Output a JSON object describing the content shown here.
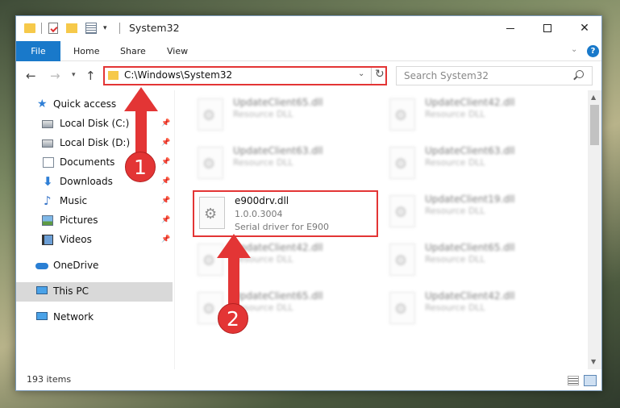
{
  "window": {
    "title": "System32",
    "quick_access_dropdown": "▾",
    "minimize": "",
    "maximize": "",
    "close": "✕"
  },
  "ribbon": {
    "tabs": [
      "File",
      "Home",
      "Share",
      "View"
    ],
    "collapse_chevron": "⌄",
    "help": "?"
  },
  "nav": {
    "back": "←",
    "forward": "→",
    "recent": "▾",
    "up": "↑",
    "address": "C:\\Windows\\System32",
    "address_dropdown": "⌄",
    "refresh": "↻",
    "search_placeholder": "Search System32"
  },
  "sidebar": {
    "items": [
      {
        "label": "Quick access",
        "icon": "star-icon",
        "pinned": false
      },
      {
        "label": "Local Disk (C:)",
        "icon": "drive-icon",
        "pinned": true
      },
      {
        "label": "Local Disk (D:)",
        "icon": "drive-icon",
        "pinned": true
      },
      {
        "label": "Documents",
        "icon": "documents-icon",
        "pinned": true
      },
      {
        "label": "Downloads",
        "icon": "downloads-icon",
        "pinned": true
      },
      {
        "label": "Music",
        "icon": "music-icon",
        "pinned": true
      },
      {
        "label": "Pictures",
        "icon": "pictures-icon",
        "pinned": true
      },
      {
        "label": "Videos",
        "icon": "videos-icon",
        "pinned": true
      },
      {
        "label": "OneDrive",
        "icon": "onedrive-icon",
        "pinned": false
      },
      {
        "label": "This PC",
        "icon": "this-pc-icon",
        "pinned": false,
        "selected": true
      },
      {
        "label": "Network",
        "icon": "network-icon",
        "pinned": false
      }
    ],
    "pin_glyph": "📌"
  },
  "files": {
    "left": [
      {
        "name": "UpdateClient65.dll",
        "type": "Resource DLL"
      },
      {
        "name": "UpdateClient63.dll",
        "type": "Resource DLL"
      },
      {
        "name": "e900drv.dll",
        "version": "1.0.0.3004",
        "description": "Serial driver for E900"
      },
      {
        "name": "UpdateClient42.dll",
        "type": "Resource DLL"
      },
      {
        "name": "UpdateClient65.dll",
        "type": "Resource DLL"
      }
    ],
    "right": [
      {
        "name": "UpdateClient42.dll",
        "type": "Resource DLL"
      },
      {
        "name": "UpdateClient63.dll",
        "type": "Resource DLL"
      },
      {
        "name": "UpdateClient19.dll",
        "type": "Resource DLL"
      },
      {
        "name": "UpdateClient65.dll",
        "type": "Resource DLL"
      },
      {
        "name": "UpdateClient42.dll",
        "type": "Resource DLL"
      }
    ]
  },
  "scrollbar": {
    "up": "▲",
    "down": "▼"
  },
  "status": {
    "item_count": "193 items"
  },
  "annotations": {
    "step1": "1",
    "step2": "2",
    "color": "#e33535"
  }
}
